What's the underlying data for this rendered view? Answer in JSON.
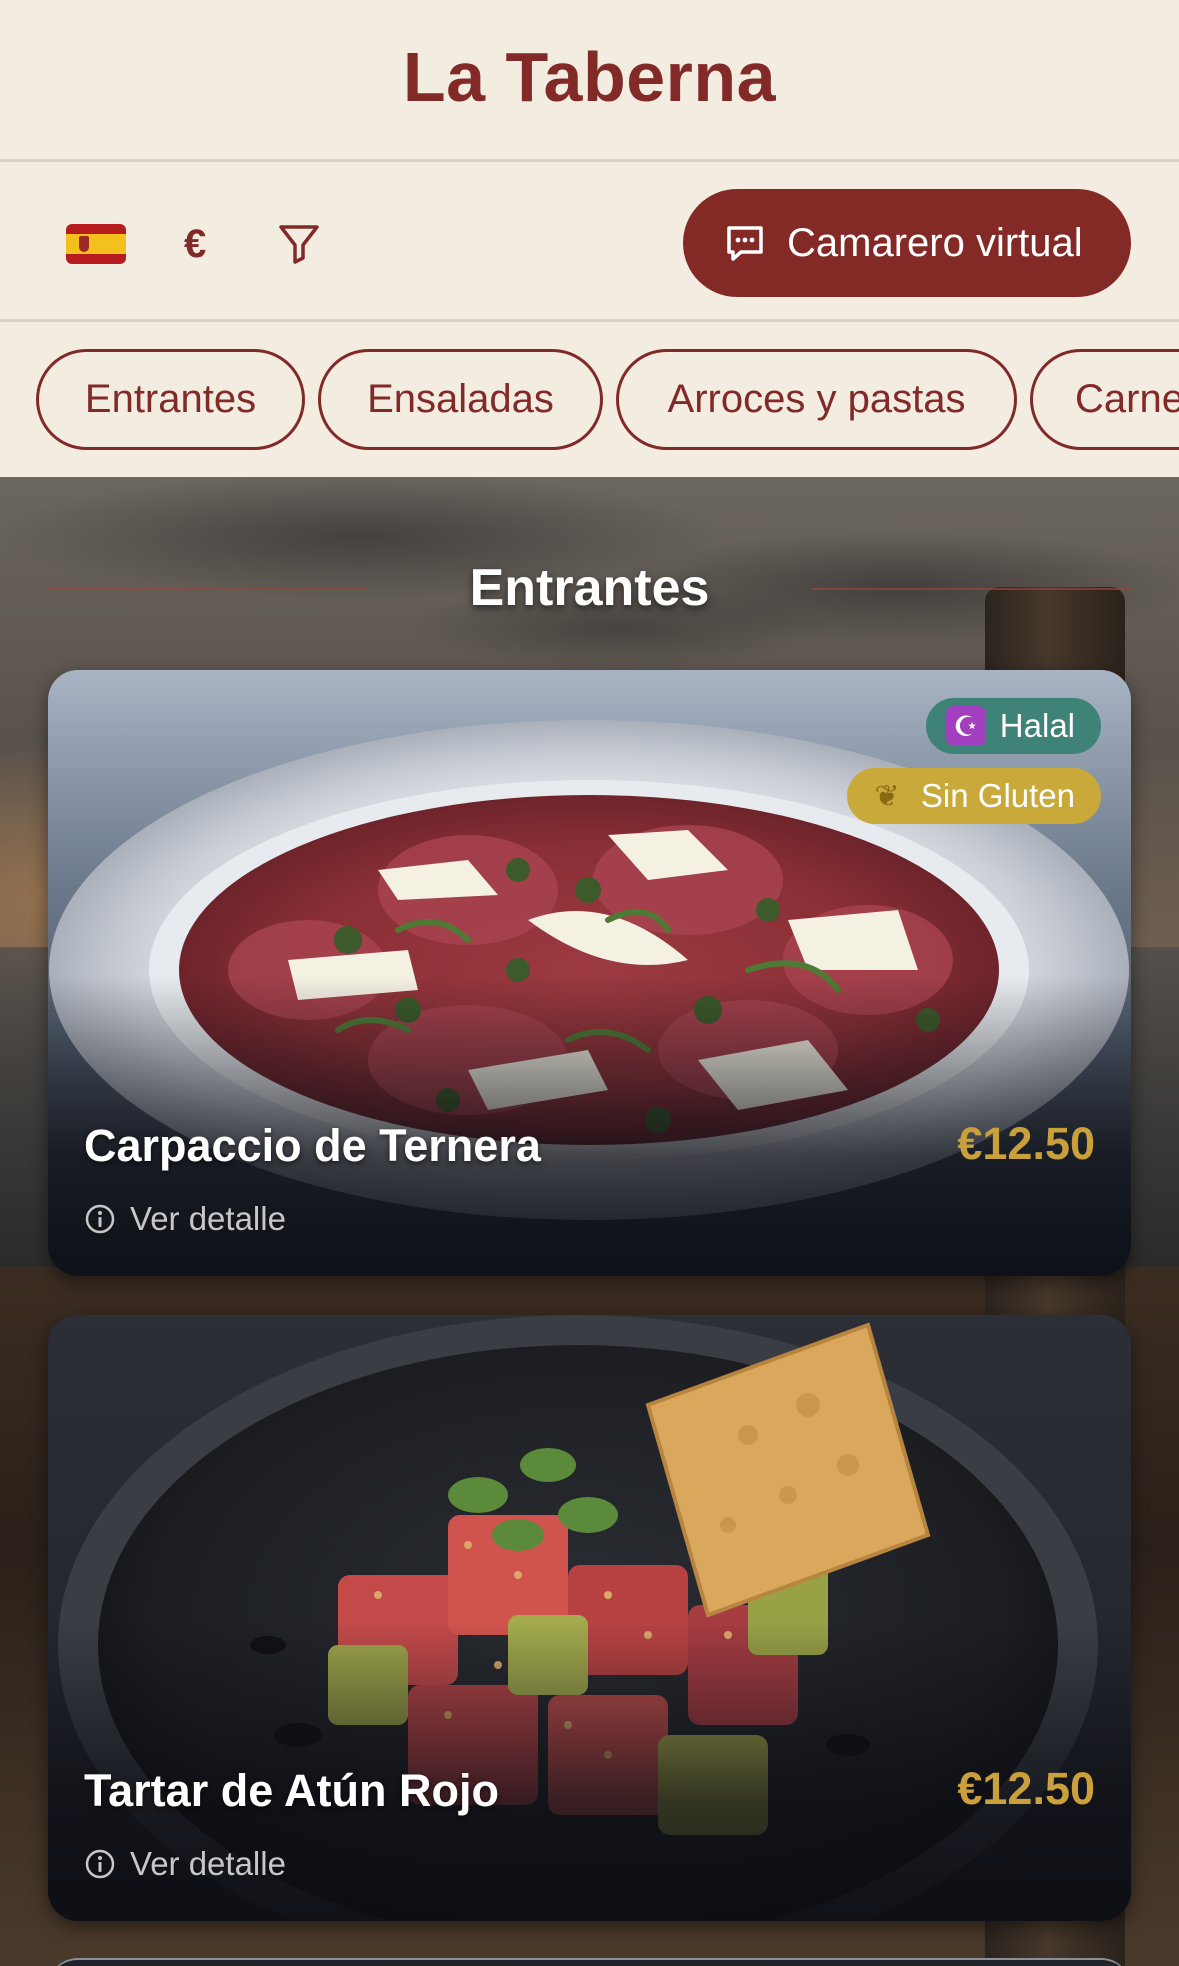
{
  "header": {
    "title": "La Taberna"
  },
  "toolbar": {
    "language_flag": "spain-flag-icon",
    "currency_symbol": "€",
    "filter_icon": "funnel-icon",
    "waiter_button_label": "Camarero virtual",
    "waiter_button_icon": "chat-bubble-icon"
  },
  "categories": [
    {
      "label": "Entrantes"
    },
    {
      "label": "Ensaladas"
    },
    {
      "label": "Arroces y pastas"
    },
    {
      "label": "Carne"
    }
  ],
  "section": {
    "title": "Entrantes"
  },
  "dishes": [
    {
      "name": "Carpaccio de Ternera",
      "price": "€12.50",
      "detail_label": "Ver detalle",
      "badges": [
        {
          "label": "Halal",
          "icon": "crescent-star-icon",
          "color": "#3f8277"
        },
        {
          "label": "Sin Gluten",
          "icon": "wheat-icon",
          "color": "#c9a93a"
        }
      ]
    },
    {
      "name": "Tartar de Atún Rojo",
      "price": "€12.50",
      "detail_label": "Ver detalle",
      "badges": []
    }
  ],
  "colors": {
    "brand": "#822a28",
    "background": "#f3ece1",
    "price": "#c9a03c"
  }
}
